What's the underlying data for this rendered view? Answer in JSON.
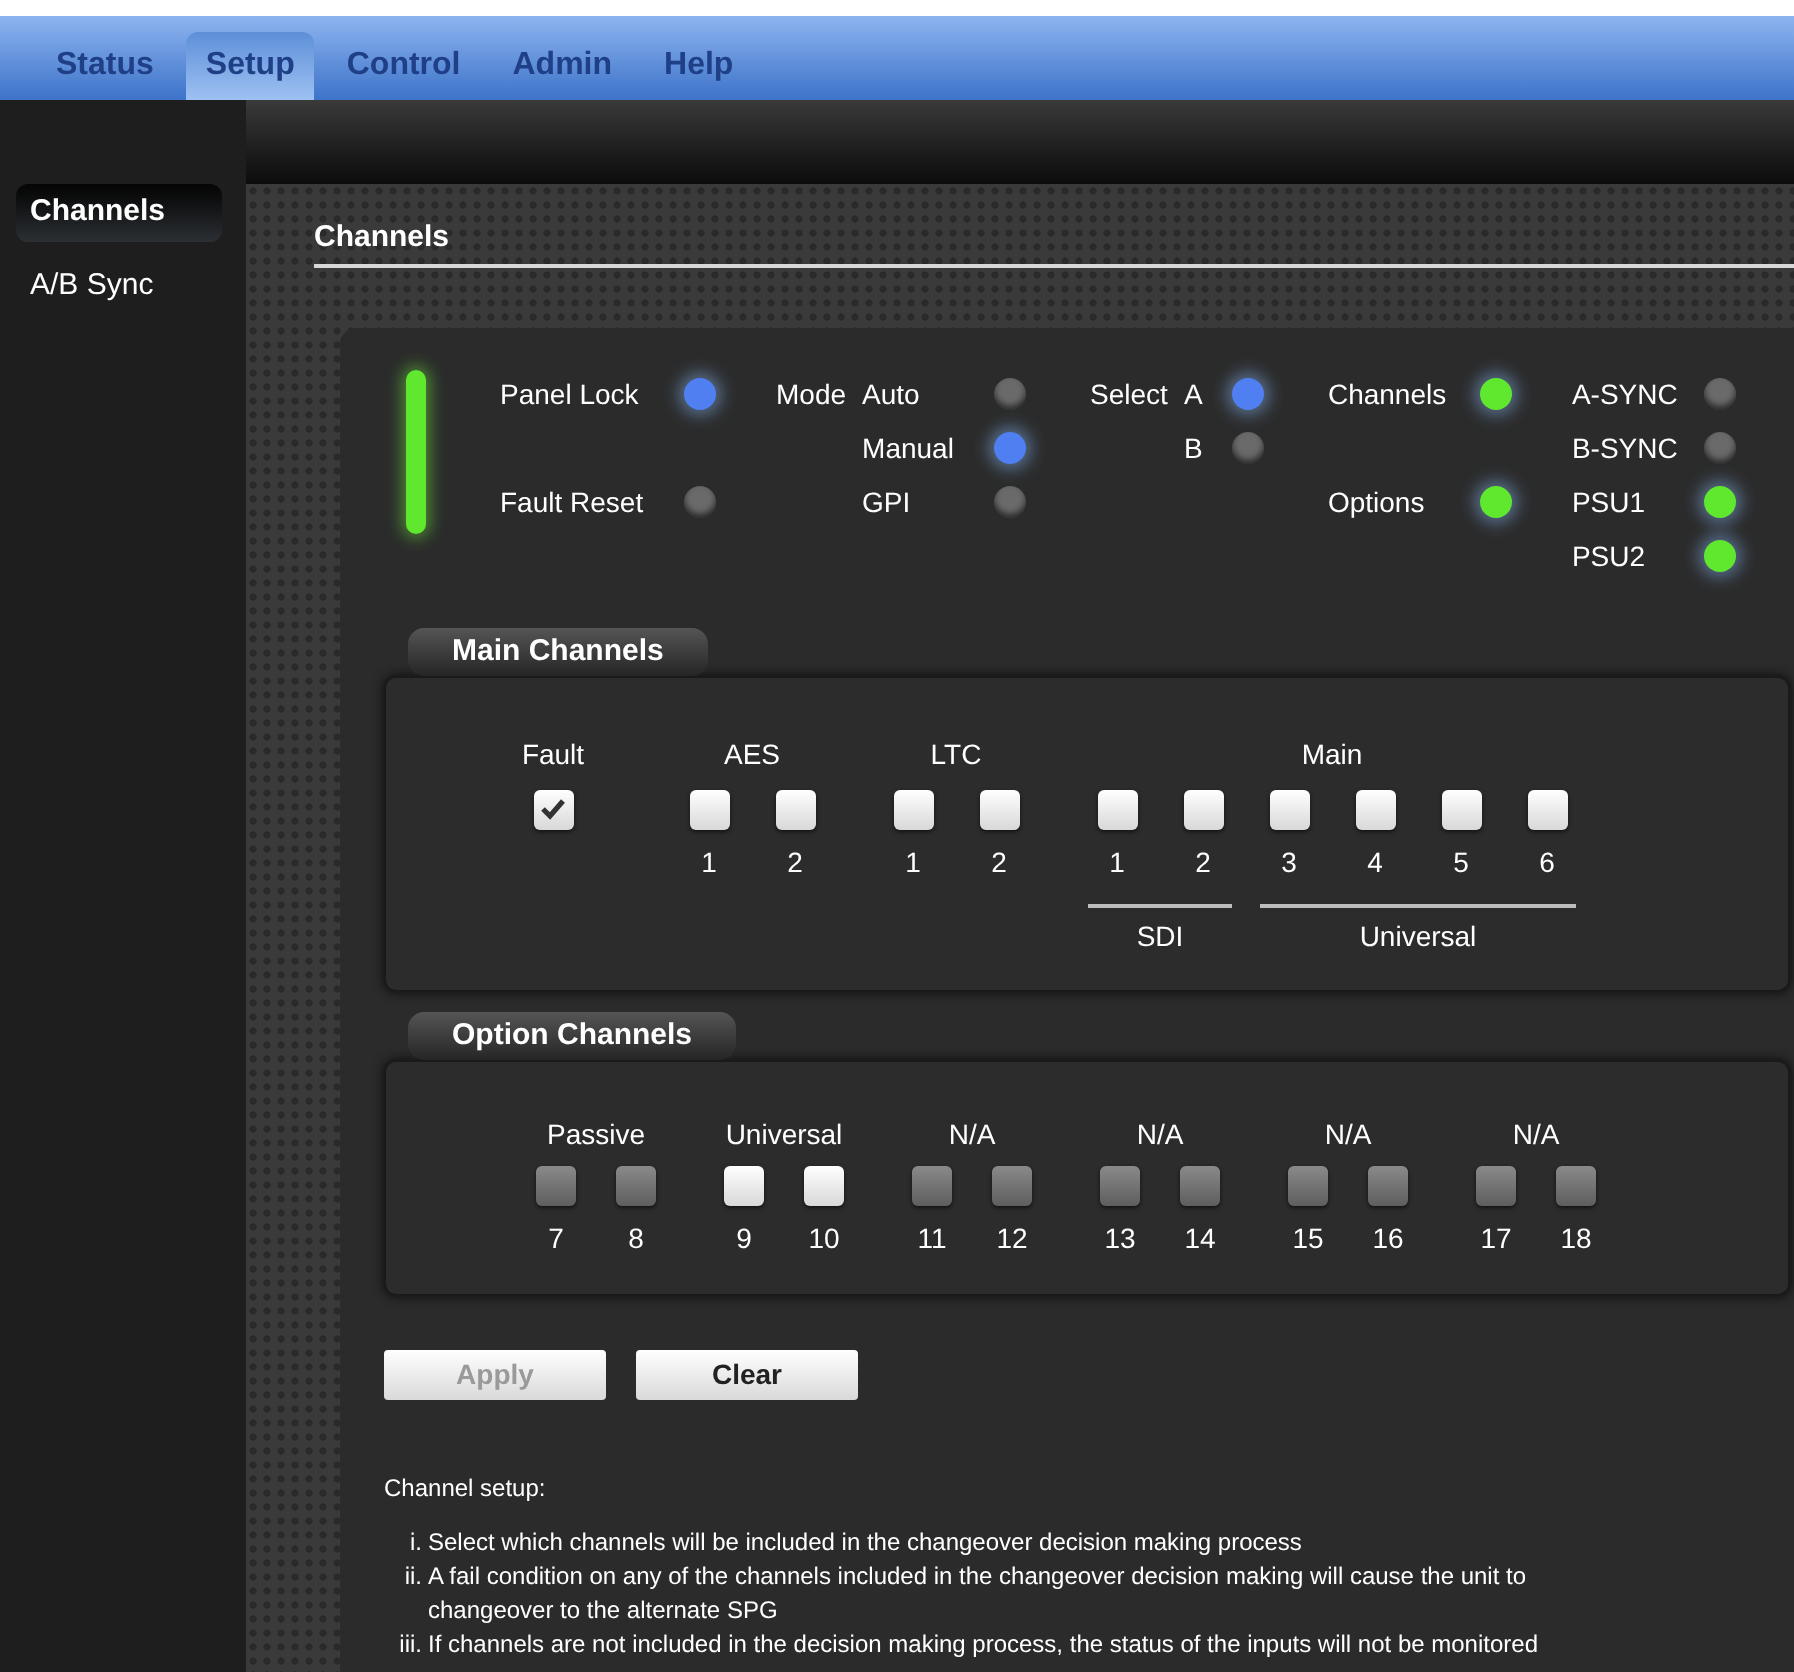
{
  "nav_tabs": [
    {
      "label": "Status",
      "selected": false
    },
    {
      "label": "Setup",
      "selected": true
    },
    {
      "label": "Control",
      "selected": false
    },
    {
      "label": "Admin",
      "selected": false
    },
    {
      "label": "Help",
      "selected": false
    }
  ],
  "sidebar": {
    "items": [
      {
        "label": "Channels",
        "selected": true
      },
      {
        "label": "A/B Sync",
        "selected": false
      }
    ]
  },
  "page_title": "Channels",
  "power_indicator": {
    "color": "#5fe82e",
    "lit": true
  },
  "status_groups": [
    {
      "items": [
        {
          "kind": "led",
          "label": "Panel Lock",
          "color": "#4f7ff0",
          "lit": true
        },
        {
          "kind": "gap"
        },
        {
          "kind": "led",
          "label": "Fault Reset",
          "color": "#6a6a6a",
          "lit": false
        }
      ]
    },
    {
      "label": "Mode",
      "items": [
        {
          "kind": "led",
          "label": "Auto",
          "color": "#6a6a6a",
          "lit": false
        },
        {
          "kind": "led",
          "label": "Manual",
          "color": "#4f7ff0",
          "lit": true
        },
        {
          "kind": "led",
          "label": "GPI",
          "color": "#6a6a6a",
          "lit": false
        }
      ]
    },
    {
      "label": "Select",
      "items": [
        {
          "kind": "led",
          "label": "A",
          "color": "#4f7ff0",
          "lit": true
        },
        {
          "kind": "led",
          "label": "B",
          "color": "#6a6a6a",
          "lit": false
        }
      ]
    },
    {
      "items": [
        {
          "kind": "led",
          "label": "Channels",
          "color": "#5fe82e",
          "lit": true
        },
        {
          "kind": "gap"
        },
        {
          "kind": "led",
          "label": "Options",
          "color": "#5fe82e",
          "lit": true
        }
      ]
    },
    {
      "items": [
        {
          "kind": "led",
          "label": "A-SYNC",
          "color": "#6a6a6a",
          "lit": false
        },
        {
          "kind": "led",
          "label": "B-SYNC",
          "color": "#6a6a6a",
          "lit": false
        },
        {
          "kind": "led",
          "label": "PSU1",
          "color": "#5fe82e",
          "lit": true
        },
        {
          "kind": "led",
          "label": "PSU2",
          "color": "#5fe82e",
          "lit": true
        }
      ]
    }
  ],
  "main_channels": {
    "title": "Main Channels",
    "groups": [
      {
        "label": "Fault",
        "boxes": [
          {
            "checked": true,
            "disabled": false
          }
        ]
      },
      {
        "label": "AES",
        "boxes": [
          {
            "number": "1",
            "checked": false,
            "disabled": false
          },
          {
            "number": "2",
            "checked": false,
            "disabled": false
          }
        ]
      },
      {
        "label": "LTC",
        "boxes": [
          {
            "number": "1",
            "checked": false,
            "disabled": false
          },
          {
            "number": "2",
            "checked": false,
            "disabled": false
          }
        ]
      },
      {
        "label": "Main",
        "subgroups": [
          {
            "label": "SDI",
            "boxes": [
              {
                "number": "1",
                "checked": false,
                "disabled": false
              },
              {
                "number": "2",
                "checked": false,
                "disabled": false
              }
            ]
          },
          {
            "label": "Universal",
            "boxes": [
              {
                "number": "3",
                "checked": false,
                "disabled": false
              },
              {
                "number": "4",
                "checked": false,
                "disabled": false
              },
              {
                "number": "5",
                "checked": false,
                "disabled": false
              },
              {
                "number": "6",
                "checked": false,
                "disabled": false
              }
            ]
          }
        ]
      }
    ]
  },
  "option_channels": {
    "title": "Option Channels",
    "groups": [
      {
        "label": "Passive",
        "boxes": [
          {
            "number": "7",
            "checked": false,
            "disabled": true
          },
          {
            "number": "8",
            "checked": false,
            "disabled": true
          }
        ]
      },
      {
        "label": "Universal",
        "boxes": [
          {
            "number": "9",
            "checked": false,
            "disabled": false
          },
          {
            "number": "10",
            "checked": false,
            "disabled": false
          }
        ]
      },
      {
        "label": "N/A",
        "boxes": [
          {
            "number": "11",
            "checked": false,
            "disabled": true
          },
          {
            "number": "12",
            "checked": false,
            "disabled": true
          }
        ]
      },
      {
        "label": "N/A",
        "boxes": [
          {
            "number": "13",
            "checked": false,
            "disabled": true
          },
          {
            "number": "14",
            "checked": false,
            "disabled": true
          }
        ]
      },
      {
        "label": "N/A",
        "boxes": [
          {
            "number": "15",
            "checked": false,
            "disabled": true
          },
          {
            "number": "16",
            "checked": false,
            "disabled": true
          }
        ]
      },
      {
        "label": "N/A",
        "boxes": [
          {
            "number": "17",
            "checked": false,
            "disabled": true
          },
          {
            "number": "18",
            "checked": false,
            "disabled": true
          }
        ]
      }
    ]
  },
  "buttons": [
    {
      "label": "Apply",
      "disabled": true
    },
    {
      "label": "Clear",
      "disabled": false
    }
  ],
  "help": {
    "heading": "Channel setup:",
    "items": [
      {
        "marker": "i.",
        "text": "Select which channels will be included in the changeover decision making process"
      },
      {
        "marker": "ii.",
        "text": "A fail condition on any of the channels included in the changeover decision making will cause the unit to changeover to the alternate SPG"
      },
      {
        "marker": "iii.",
        "text": "If channels are not included in the decision making process, the status of the inputs will not be monitored"
      }
    ]
  }
}
